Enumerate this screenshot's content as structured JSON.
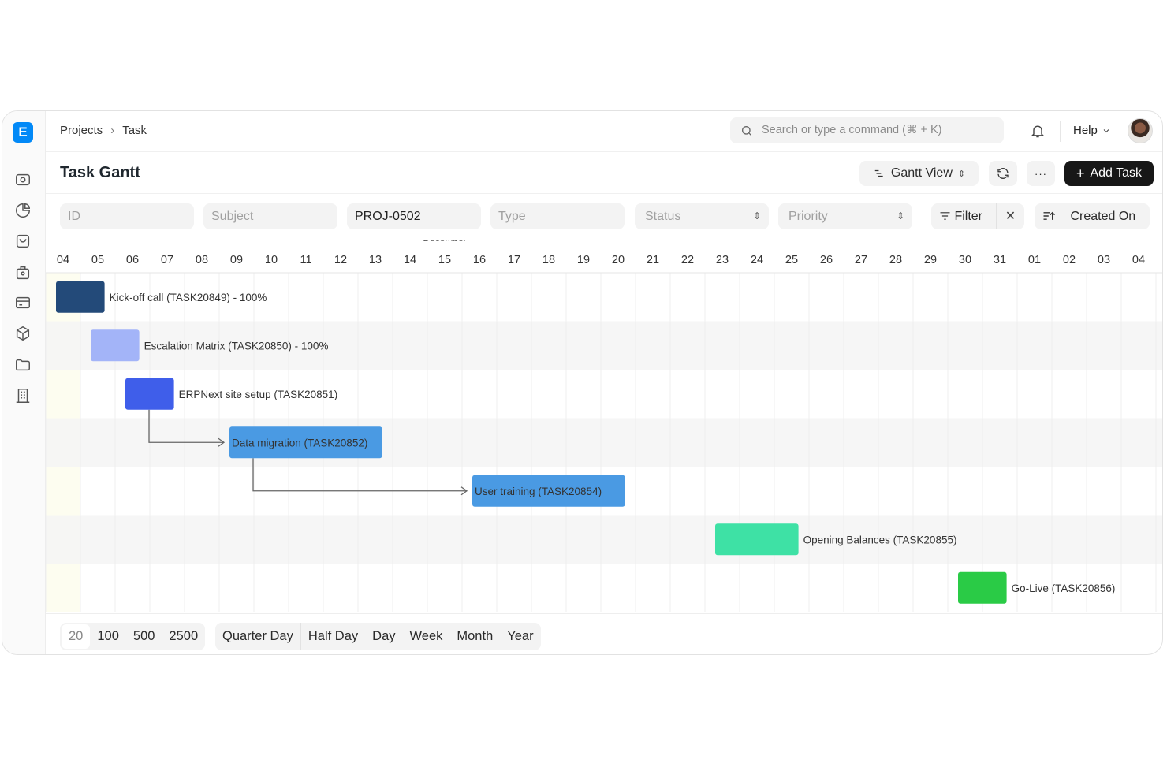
{
  "app": {
    "logo_letter": "E"
  },
  "sidebar": {
    "icons": [
      "eye-icon",
      "pie-chart-icon",
      "shopping-bag-icon",
      "briefcase-icon",
      "credit-card-icon",
      "box-icon",
      "folder-icon",
      "building-icon"
    ]
  },
  "breadcrumb": {
    "items": [
      "Projects",
      "Task"
    ]
  },
  "search": {
    "placeholder": "Search or type a command (⌘ + K)"
  },
  "topbar": {
    "help_label": "Help"
  },
  "page": {
    "title": "Task Gantt"
  },
  "actions": {
    "view_label": "Gantt View",
    "more_label": "···",
    "add_label": "Add Task"
  },
  "filters": {
    "id_placeholder": "ID",
    "subject_placeholder": "Subject",
    "project_value": "PROJ-0502",
    "type_placeholder": "Type",
    "status_placeholder": "Status",
    "priority_placeholder": "Priority",
    "filter_label": "Filter",
    "sort_label": "Created On"
  },
  "chart_data": {
    "type": "gantt",
    "month_label": "December",
    "days": [
      "04",
      "05",
      "06",
      "07",
      "08",
      "09",
      "10",
      "11",
      "12",
      "13",
      "14",
      "15",
      "16",
      "17",
      "18",
      "19",
      "20",
      "21",
      "22",
      "23",
      "24",
      "25",
      "26",
      "27",
      "28",
      "29",
      "30",
      "31",
      "01",
      "02",
      "03",
      "04"
    ],
    "tasks": [
      {
        "label": "Kick-off call (TASK20849) - 100%",
        "start": 0,
        "end": 1.4,
        "color": "#234a79",
        "label_inside": false
      },
      {
        "label": "Escalation Matrix (TASK20850) - 100%",
        "start": 1,
        "end": 2.4,
        "color": "#a3b4f8",
        "label_inside": false
      },
      {
        "label": "ERPNext site setup (TASK20851)",
        "start": 2,
        "end": 3.4,
        "color": "#3f5eea",
        "label_inside": false
      },
      {
        "label": "Data migration (TASK20852)",
        "start": 5,
        "end": 9.4,
        "color": "#4a9ae3",
        "label_inside": true
      },
      {
        "label": "User training (TASK20854)",
        "start": 12,
        "end": 16.4,
        "color": "#4a9ae3",
        "label_inside": true
      },
      {
        "label": "Opening Balances (TASK20855)",
        "start": 19,
        "end": 21.4,
        "color": "#3ee1a5",
        "label_inside": false
      },
      {
        "label": "Go-Live (TASK20856)",
        "start": 26,
        "end": 27.4,
        "color": "#2acb46",
        "label_inside": false
      }
    ],
    "dependencies": [
      {
        "from": 2,
        "to": 3
      },
      {
        "from": 3,
        "to": 4
      }
    ]
  },
  "footer": {
    "page_sizes": [
      "20",
      "100",
      "500",
      "2500"
    ],
    "view_modes": [
      "Quarter Day",
      "Half Day",
      "Day",
      "Week",
      "Month",
      "Year"
    ]
  }
}
